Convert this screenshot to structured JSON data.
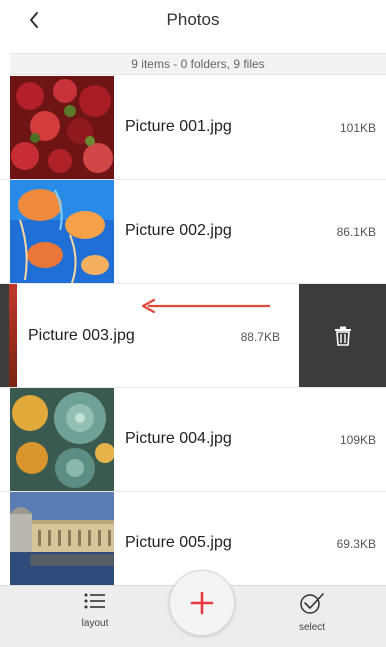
{
  "header": {
    "title": "Photos",
    "back_icon": "chevron-left-icon"
  },
  "summary": "9 items - 0 folders, 9 files",
  "files": [
    {
      "name": "Picture 001.jpg",
      "size": "101KB",
      "thumb": "red-foliage"
    },
    {
      "name": "Picture 002.jpg",
      "size": "86.1KB",
      "thumb": "jellyfish"
    },
    {
      "name": "Picture 003.jpg",
      "size": "88.7KB",
      "thumb": "red-edge",
      "swiped": true
    },
    {
      "name": "Picture 004.jpg",
      "size": "109KB",
      "thumb": "succulents"
    },
    {
      "name": "Picture 005.jpg",
      "size": "69.3KB",
      "thumb": "building"
    }
  ],
  "swipe": {
    "delete_icon": "trash-icon",
    "arrow_color": "#e04a3a"
  },
  "toolbar": {
    "layout_label": "layout",
    "layout_icon": "list-icon",
    "select_label": "select",
    "select_icon": "checkmark-circle-icon",
    "add_icon": "plus-icon",
    "add_color": "#e8383d"
  }
}
